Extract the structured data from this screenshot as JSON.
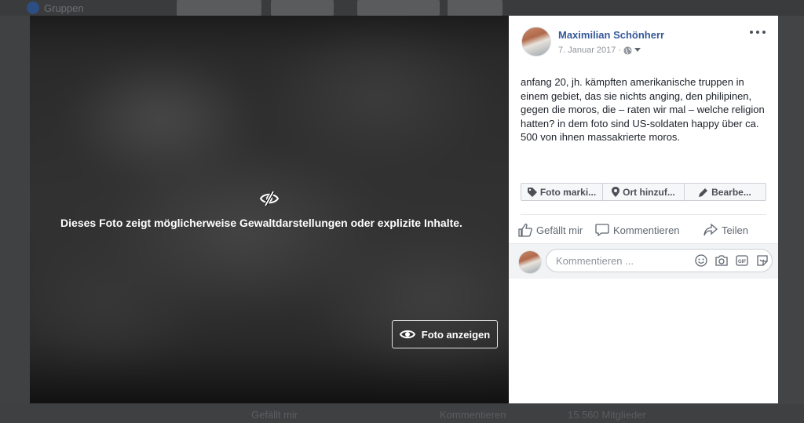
{
  "background": {
    "groups_label": "Gruppen",
    "bottom_like": "Gefällt mir",
    "bottom_comment": "Kommentieren",
    "bottom_members": "15.560 Mitglieder"
  },
  "photo": {
    "warning_text": "Dieses Foto zeigt möglicherweise Gewaltdarstellungen oder explizite Inhalte.",
    "show_button_label": "Foto anzeigen",
    "warning_icon": "eye-slash-icon",
    "show_icon": "eye-icon"
  },
  "post": {
    "author": "Maximilian Schönherr",
    "date": "7. Januar 2017",
    "privacy_icon": "globe-icon",
    "text": "anfang 20, jh. kämpften amerikanische truppen in einem gebiet, das sie nichts anging, den philipinen, gegen die moros, die – raten wir mal – welche religion hatten? in dem foto sind US-soldaten happy über ca. 500 von ihnen massakrierte moros.",
    "tag_buttons": [
      {
        "label": "Foto marki...",
        "icon": "tag-icon"
      },
      {
        "label": "Ort hinzuf...",
        "icon": "location-pin-icon"
      },
      {
        "label": "Bearbe...",
        "icon": "pencil-icon"
      }
    ],
    "actions": {
      "like": "Gefällt mir",
      "comment": "Kommentieren",
      "share": "Teilen"
    },
    "comment_placeholder": "Kommentieren ...",
    "comment_icons": [
      "smiley-icon",
      "camera-icon",
      "gif-icon",
      "sticker-icon"
    ]
  },
  "colors": {
    "link_blue": "#365899",
    "muted": "#90949c"
  }
}
